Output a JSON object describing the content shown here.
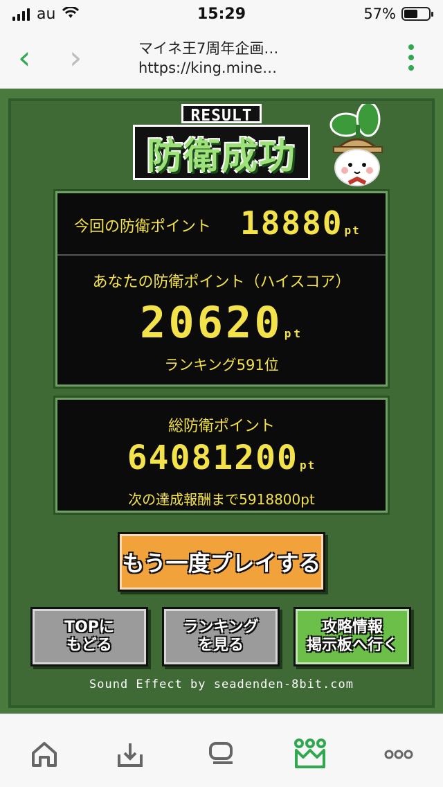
{
  "status": {
    "carrier": "au",
    "time": "15:29",
    "battery": "57%",
    "battery_level": 0.57
  },
  "browser": {
    "title": "マイネ王7周年企画…",
    "url": "https://king.mine…"
  },
  "game": {
    "result_label": "RESULT",
    "title": "防衛成功",
    "current_label": "今回の防衛ポイント",
    "current_value": "18880",
    "pt": "pt",
    "highscore_label": "あなたの防衛ポイント（ハイスコア）",
    "highscore_value": "20620",
    "ranking": "ランキング591位",
    "total_label": "総防衛ポイント",
    "total_value": "64081200",
    "next_goal": "次の達成報酬まで5918800pt",
    "replay_button": "もう一度プレイする",
    "top_button": "TOPに\nもどる",
    "ranking_button": "ランキング\nを見る",
    "info_button": "攻略情報\n掲示板へ行く",
    "sound_credit": "Sound Effect by seadenden-8bit.com"
  },
  "colors": {
    "accent": "#2fa84f",
    "panel_text": "#f4e24a",
    "bg_green": "#3f6a35"
  },
  "tabs": [
    {
      "icon": "home-icon"
    },
    {
      "icon": "share-icon"
    },
    {
      "icon": "chat-icon"
    },
    {
      "icon": "crown-icon"
    },
    {
      "icon": "more-icon"
    }
  ]
}
